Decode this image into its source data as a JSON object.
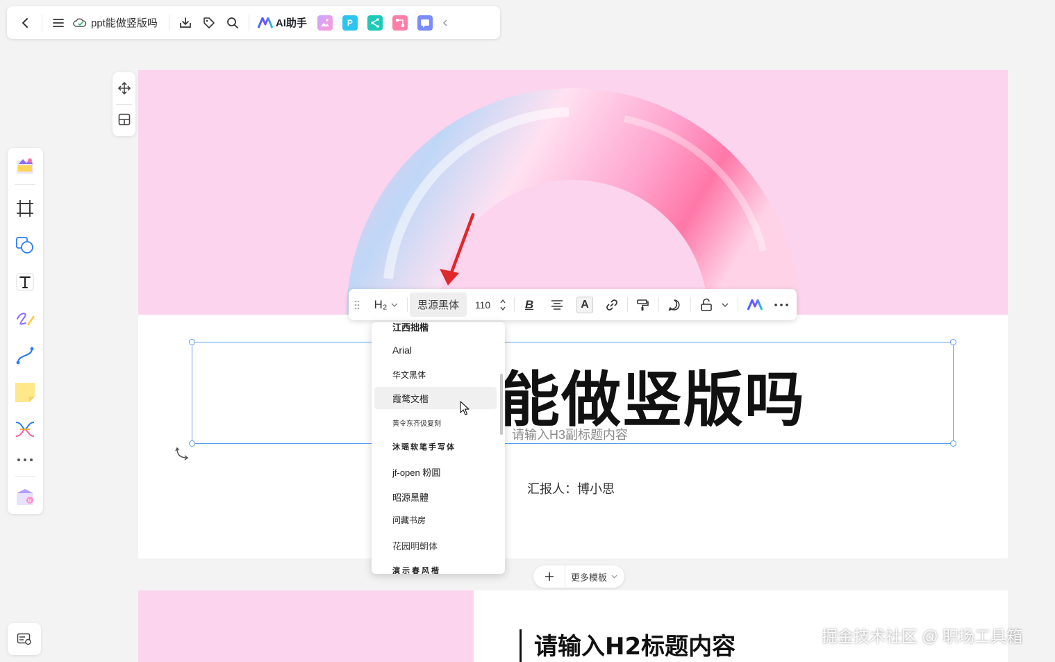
{
  "topbar": {
    "doc_title": "ppt能做竖版吗",
    "ai_label": "AI助手",
    "plugin_p_letter": "P"
  },
  "format_toolbar": {
    "heading_label": "H₂",
    "font_name": "思源黑体",
    "font_size": "110",
    "bold_label": "B",
    "color_label": "A"
  },
  "font_dropdown": {
    "options": [
      "江西拙楷",
      "Arial",
      "华文黑体",
      "霞鹜文楷",
      "黄令东齐伋复刻",
      "沐瑶软笔手写体",
      "jf-open 粉圓",
      "昭源黑體",
      "问藏书房",
      "花园明朝体",
      "演示春风楷"
    ],
    "highlighted_index": 3
  },
  "slide1": {
    "title_visible": "能做竖版吗",
    "subtitle": "请输入H3副标题内容",
    "reporter": "汇报人：博小思"
  },
  "add_slide": {
    "more_templates": "更多模板"
  },
  "slide2": {
    "h2_title": "请输入H2标题内容"
  },
  "watermark": "掘金技术社区 @ 职场工具箱",
  "colors": {
    "slide_pink": "#fcd4ee",
    "selection_blue": "#5b9cf0",
    "arrow_red": "#e0272a"
  }
}
